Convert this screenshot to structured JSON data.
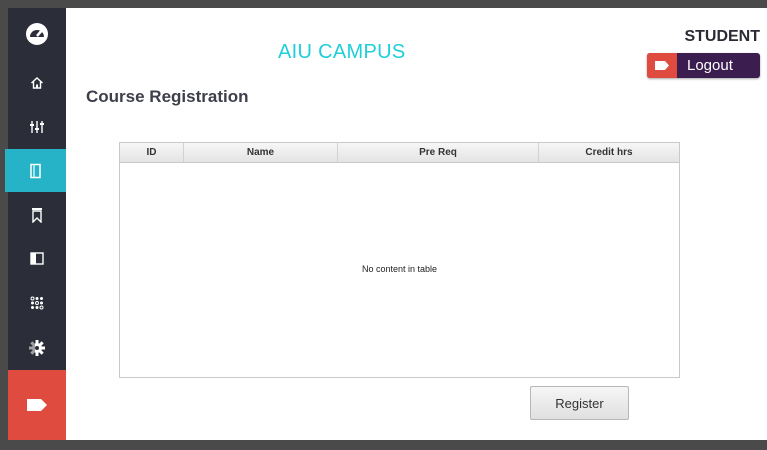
{
  "header": {
    "campus_title": "AIU CAMPUS",
    "user_role": "STUDENT",
    "logout_label": "Logout"
  },
  "page": {
    "title": "Course Registration"
  },
  "sidebar": {
    "items": [
      {
        "icon": "dashboard-gauge-icon"
      },
      {
        "icon": "home-icon"
      },
      {
        "icon": "sliders-icon"
      },
      {
        "icon": "book-icon",
        "active": true
      },
      {
        "icon": "bookmark-icon"
      },
      {
        "icon": "panel-icon"
      },
      {
        "icon": "grid-dots-icon"
      },
      {
        "icon": "gear-icon"
      },
      {
        "icon": "logout-tag-icon"
      }
    ]
  },
  "table": {
    "columns": [
      "ID",
      "Name",
      "Pre Req",
      "Credit hrs"
    ],
    "rows": [],
    "empty_text": "No content in table"
  },
  "actions": {
    "register_label": "Register"
  },
  "colors": {
    "sidebar_bg": "#2b2e38",
    "active_accent": "#27b3c7",
    "logout_red": "#e04b3f",
    "logout_purple": "#3b1d4f",
    "title_cyan": "#1ecfd9"
  }
}
